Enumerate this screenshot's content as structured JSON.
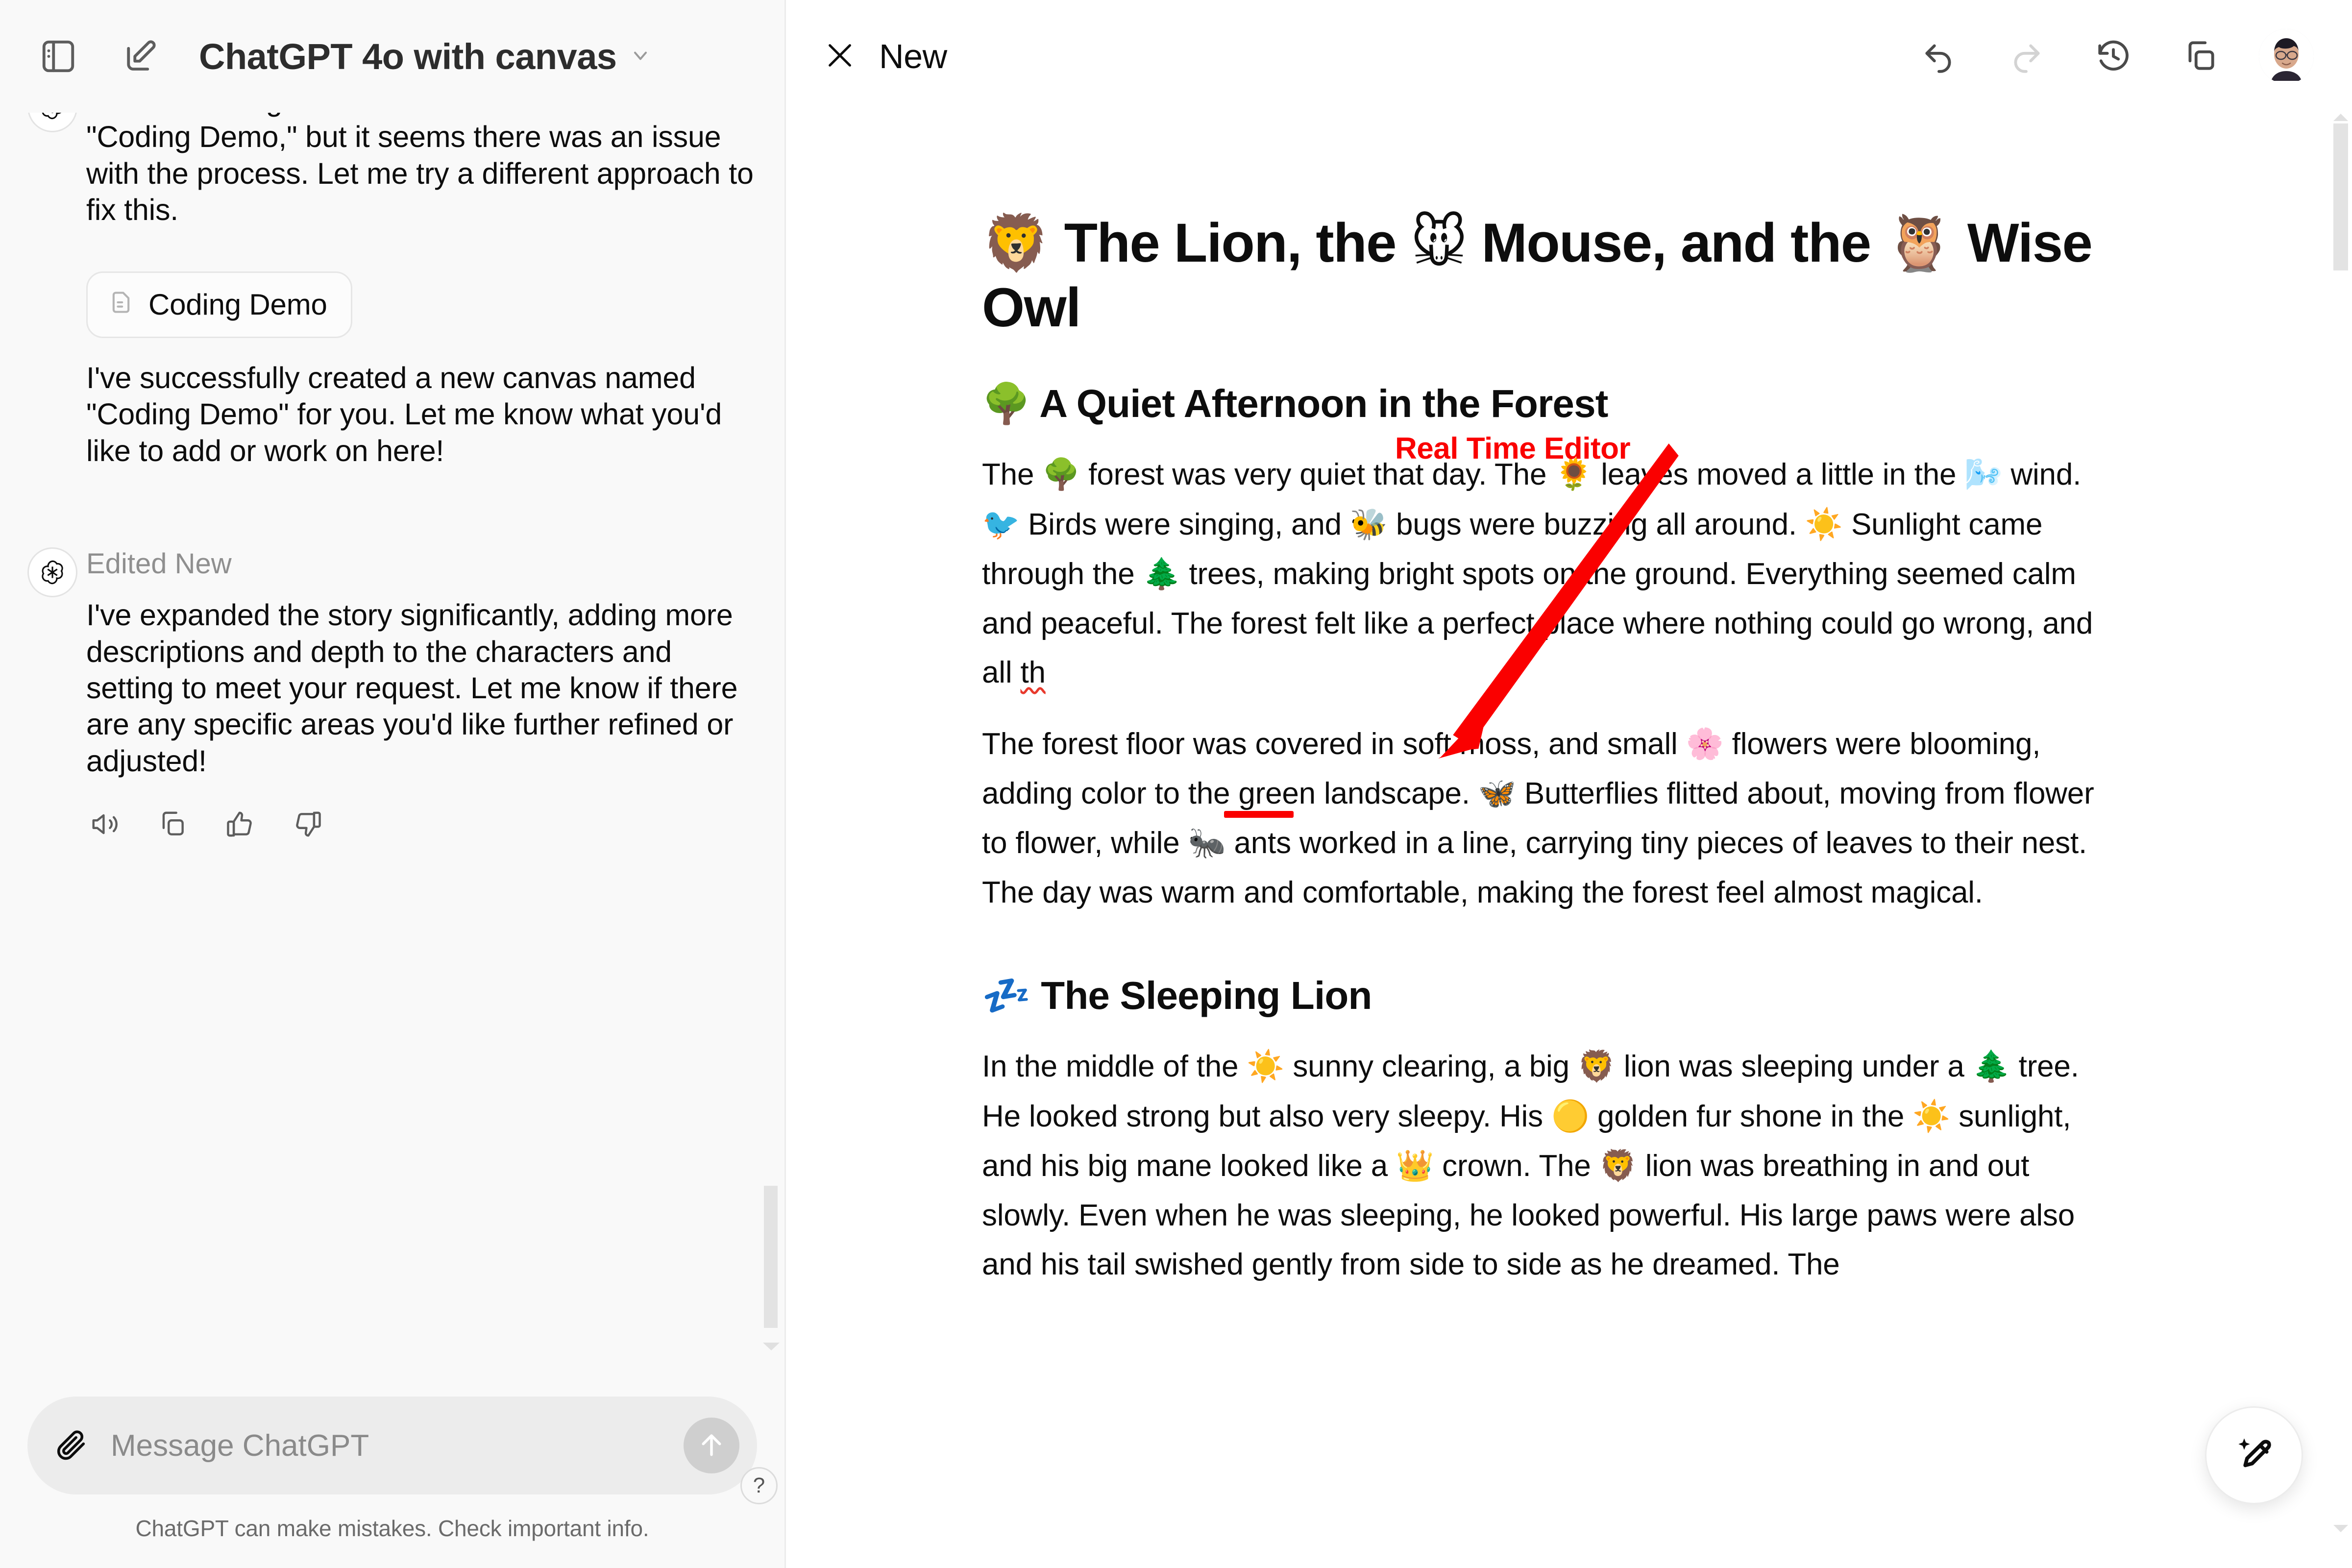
{
  "sidebar": {
    "toolbar": {
      "panel_toggle_name": "sidebar-toggle-icon",
      "new_chat_name": "new-chat-icon",
      "model_label": "ChatGPT 4o with canvas",
      "chevron": "⌄"
    },
    "messages": [
      {
        "role": "assistant",
        "paragraphs": [
          "I tried to change the name of the canvas to \"Coding Demo,\" but it seems there was an issue with the process. Let me try a different approach to fix this."
        ],
        "chip_label": "Coding Demo",
        "after_chip": "I've successfully created a new canvas named \"Coding Demo\" for you. Let me know what you'd like to add or work on here!"
      },
      {
        "role": "assistant",
        "header": "Edited New",
        "paragraphs": [
          "I've expanded the story significantly, adding more descriptions and depth to the characters and setting to meet your request. Let me know if there are any specific areas you'd like further refined or adjusted!"
        ],
        "actions": [
          "read-aloud",
          "copy",
          "thumbs-up",
          "thumbs-down"
        ]
      }
    ],
    "composer": {
      "placeholder": "Message ChatGPT",
      "attach_icon": "paperclip-icon",
      "send_icon": "send-arrow-up-icon"
    },
    "disclaimer": "ChatGPT can make mistakes. Check important info.",
    "help_label": "?"
  },
  "canvas": {
    "titlebar": {
      "close_label": "×",
      "title": "New",
      "tools": [
        "undo",
        "redo",
        "version-history",
        "copy",
        "avatar"
      ]
    },
    "document": {
      "title_parts": [
        {
          "emoji": "🦁"
        },
        {
          "text": " The Lion, the "
        },
        {
          "emoji": "🐭"
        },
        {
          "text": " Mouse, and the "
        },
        {
          "emoji": "🦉"
        },
        {
          "text": " Wise Owl"
        }
      ],
      "title_plain": "🦁 The Lion, the 🐭 Mouse, and the 🦉 Wise Owl",
      "sections": [
        {
          "heading": "🌳 A Quiet Afternoon in the Forest",
          "heading_emoji": "🌳",
          "heading_text": "A Quiet Afternoon in the Forest",
          "paragraphs": [
            {
              "text": "The 🌳 forest was very quiet that day. The 🍃 leaves moved a little in the 🌬️ wind. 🐦 Birds were singing, and 🐝 bugs were buzzing all around. ☀️ Sunlight came through the 🌲 trees, making bright spots on the ground. Everything seemed calm and peaceful. The forest felt like a perfect place where nothing could go wrong, and all th",
              "truncated": true,
              "typo_word": "th"
            },
            {
              "text": "The forest floor was covered in soft moss, and small 🌸 flowers were blooming, adding color to the green landscape. 🦋 Butterflies flitted about, moving from flower to flower, while 🐜 ants worked in a line, carrying tiny pieces of leaves to their nest. The day was warm and comfortable, making the forest feel almost magical.",
              "truncated": false
            }
          ]
        },
        {
          "heading": "💤 The Sleeping Lion",
          "heading_emoji": "💤",
          "heading_text": "The Sleeping Lion",
          "paragraphs": [
            {
              "text": "In the middle of the ☀️ sunny clearing, a big 🦁 lion was sleeping under a 🌲 tree. He looked strong but also very sleepy. His 🟡 golden fur shone in the ☀️ sunlight, and his big mane looked like a 👑 crown. The 🦁 lion was breathing in and out slowly. Even when he was sleeping, he looked powerful. His large paws were also and his tail swished gently from side to side as he dreamed. The",
              "truncated": false
            }
          ]
        }
      ]
    },
    "annotation": {
      "label": "Real Time Editor",
      "color": "#fa0000"
    },
    "fab": {
      "icon": "magic-edit-icon"
    }
  }
}
